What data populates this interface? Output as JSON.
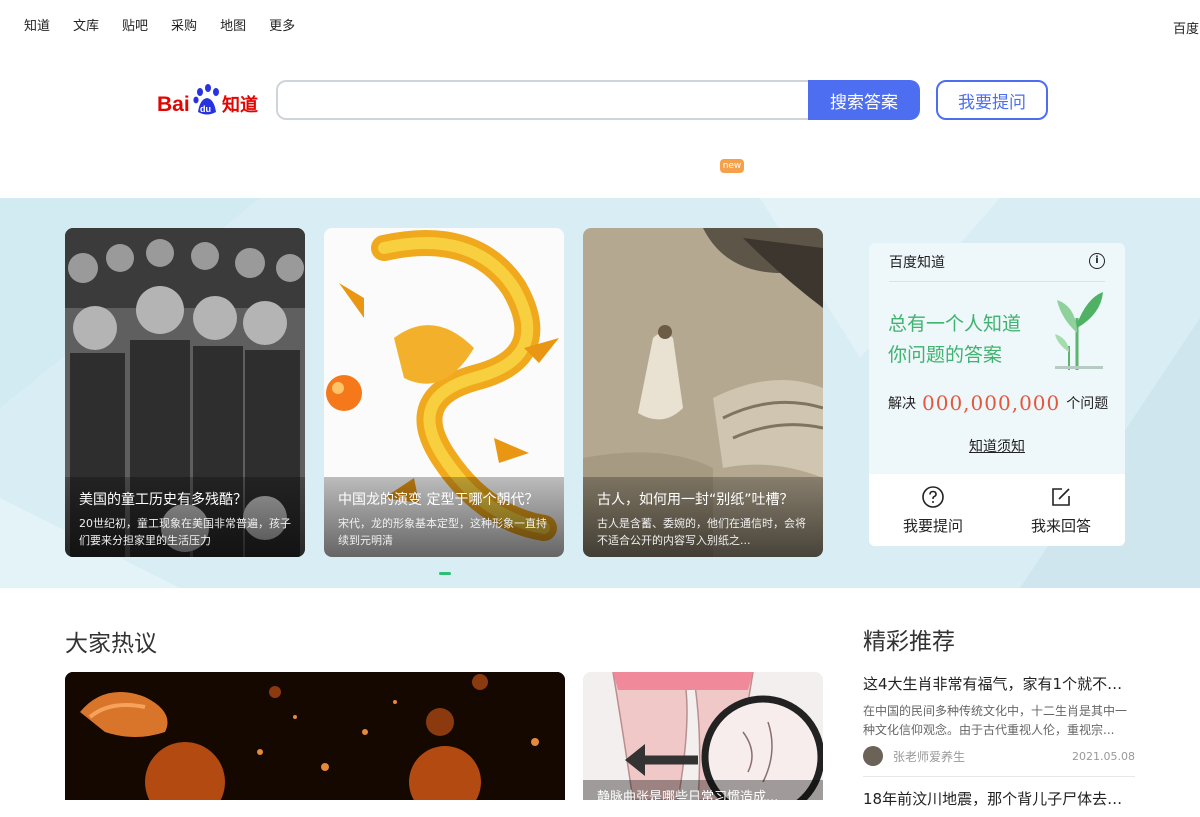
{
  "topnav": {
    "links": [
      "知道",
      "文库",
      "贴吧",
      "采购",
      "地图",
      "更多"
    ],
    "right": "百度"
  },
  "search": {
    "query": "",
    "placeholder": "",
    "search_button": "搜索答案",
    "ask_button": "我要提问",
    "badge": "new"
  },
  "carousel": [
    {
      "title": "美国的童工历史有多残酷？",
      "desc": "20世纪初，童工现象在美国非常普遍，孩子们要来分担家里的生活压力"
    },
    {
      "title": "中国龙的演变 定型于哪个朝代？",
      "desc": "宋代，龙的形象基本定型，这种形象一直持续到元明清"
    },
    {
      "title": "古人，如何用一封“别纸”吐槽？",
      "desc": "古人是含蓄、委婉的，他们在通信时，会将不适合公开的内容写入别纸之..."
    }
  ],
  "panel": {
    "header": "百度知道",
    "slogan_line1": "总有一个人知道",
    "slogan_line2": "你问题的答案",
    "solved_prefix": "解决",
    "solved_count": "000,000,000",
    "solved_suffix": "个问题",
    "rules_link": "知道须知",
    "ask_label": "我要提问",
    "answer_label": "我来回答"
  },
  "hot": {
    "title": "大家热议",
    "small_caption": "静脉曲张是哪些日常习惯造成..."
  },
  "recommend": {
    "title": "精彩推荐",
    "items": [
      {
        "title": "这4大生肖非常有福气，家有1个就不…",
        "desc": "在中国的民间多种传统文化中，十二生肖是其中一种文化信仰观念。由于古代重视人伦，重视宗...",
        "author": "张老师爱养生",
        "date": "2021.05.08"
      },
      {
        "title": "18年前汶川地震，那个背儿子尸体去…"
      }
    ]
  },
  "colors": {
    "accent": "#4e6ef2",
    "hero_bg": "#d9eef4",
    "slogan_green": "#3fb36f",
    "count_red": "#e4573f"
  }
}
